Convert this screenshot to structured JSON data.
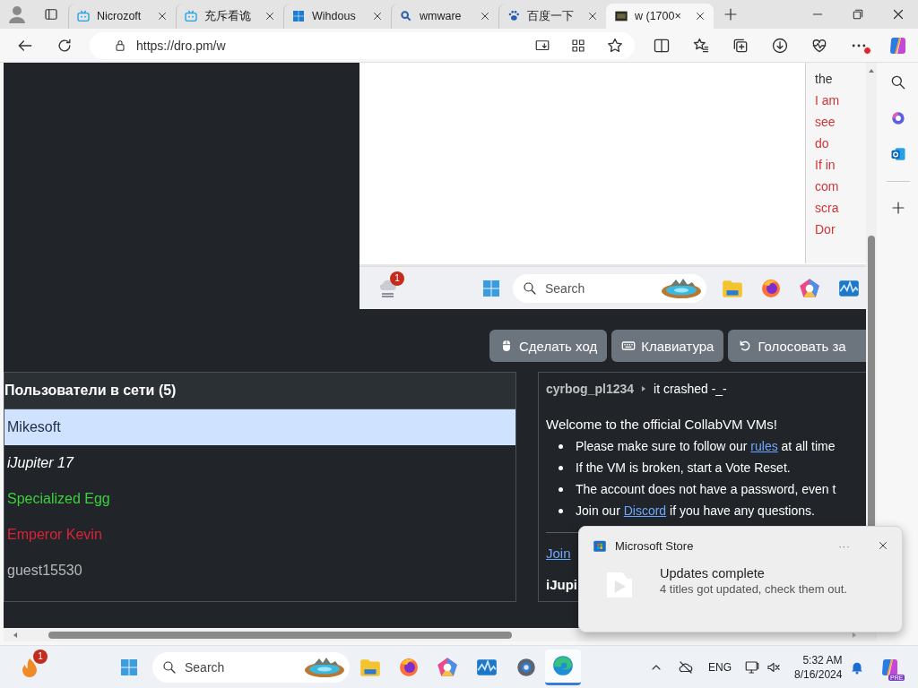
{
  "browser": {
    "tabs": [
      {
        "title": "Nicrozoft",
        "selected": false
      },
      {
        "title": "充斥看诡",
        "selected": false
      },
      {
        "title": "Wihdous",
        "selected": false
      },
      {
        "title": "wmware",
        "selected": false
      },
      {
        "title": "百度一下",
        "selected": false
      },
      {
        "title": "w (1700×",
        "selected": true
      }
    ],
    "url": "https://dro.pm/w"
  },
  "vm": {
    "side_lines": [
      {
        "text": "the",
        "color": "#333333"
      },
      {
        "text": "I am",
        "color": "#d13438"
      },
      {
        "text": "see",
        "color": "#d13438"
      },
      {
        "text": "do",
        "color": "#d13438"
      },
      {
        "text": "If in",
        "color": "#d13438"
      },
      {
        "text": "com",
        "color": "#d13438"
      },
      {
        "text": "scra",
        "color": "#d13438"
      },
      {
        "text": "Dor",
        "color": "#d13438"
      }
    ],
    "taskbar": {
      "widget_badge": "1",
      "search_label": "Search"
    }
  },
  "actions": [
    {
      "label": "Сделать ход",
      "kind": "mouse"
    },
    {
      "label": "Клавиатура",
      "kind": "keyboard"
    },
    {
      "label": "Голосовать за",
      "kind": "vote"
    }
  ],
  "users": {
    "title": "Пользователи в сети (5)",
    "items": [
      {
        "name": "Mikesoft",
        "selected": true,
        "italic": false,
        "color": "#1f2d3d"
      },
      {
        "name": "iJupiter 17",
        "selected": false,
        "italic": true,
        "color": "#ffffff"
      },
      {
        "name": "Specialized Egg",
        "selected": false,
        "italic": false,
        "color": "#3ccf3c"
      },
      {
        "name": "Emperor Kevin",
        "selected": false,
        "italic": false,
        "color": "#dc2335"
      },
      {
        "name": "guest15530",
        "selected": false,
        "italic": false,
        "color": "#b8b8b8"
      }
    ]
  },
  "chat": {
    "messages": [
      {
        "user": "cyrbog_pl1234",
        "text": "it crashed -_-"
      }
    ],
    "welcome": "Welcome to the official CollabVM VMs!",
    "rules": [
      {
        "before": "Please make sure to follow our ",
        "link": "rules",
        "after": " at all time"
      },
      {
        "before": "If the VM is broken, start a Vote Reset."
      },
      {
        "before": "The account does not have a password, even t"
      },
      {
        "before": "Join our ",
        "link": "Discord",
        "after": " if you have any questions."
      }
    ],
    "footer_link": "Join",
    "next_user": "iJupi"
  },
  "notification": {
    "app": "Microsoft Store",
    "more": "···",
    "title": "Updates complete",
    "body": "4 titles got updated, check them out."
  },
  "taskbar": {
    "app_badge": "1",
    "search_label": "Search",
    "language": "ENG",
    "time": "5:32 AM",
    "date": "8/16/2024",
    "copilot_badge": "PRE"
  }
}
